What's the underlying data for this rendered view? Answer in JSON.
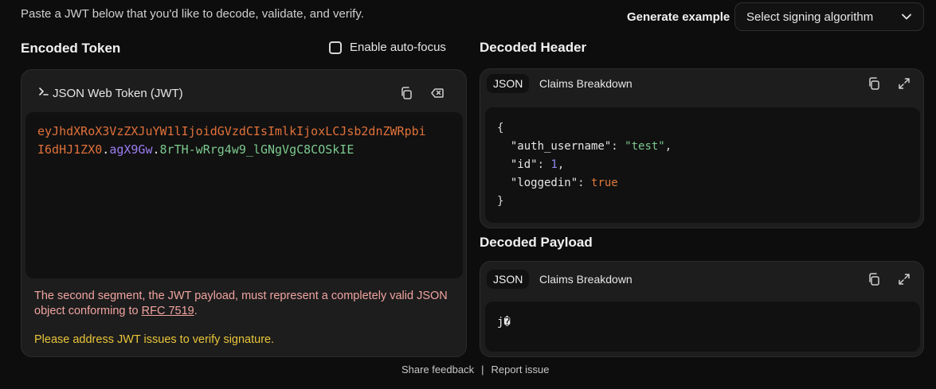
{
  "intro_text": "Paste a JWT below that you'd like to decode, validate, and verify.",
  "generate_example_label": "Generate example",
  "algorithm_select": {
    "value": "Select signing algorithm"
  },
  "encoded": {
    "title": "Encoded Token",
    "autofocus_label": "Enable auto-focus",
    "panel_title": "JSON Web Token (JWT)",
    "token_header_part": "eyJhdXRoX3VzZXJuYW1lIjoidGVzdCIsImlkIjoxLCJsb2dnZWRpbiI6dHJ1ZX0",
    "token_header_line1": "eyJhdXRoX3VzZXJuYW1lIjoidGVzdCIsImlkIjoxLCJsb2dnZWRpbi",
    "token_header_line2": "I6dHJ1ZX0",
    "dot1": ".",
    "token_payload_part": "agX9Gw",
    "dot2": ".",
    "token_signature_part": "8rTH-wRrg4w9_lGNgVgC8COSkIE",
    "error_text": "The second segment, the JWT payload, must represent a completely valid JSON object conforming to ",
    "error_link": "RFC 7519",
    "error_end": ".",
    "warning_text": "Please address JWT issues to verify signature."
  },
  "decoded_header": {
    "title": "Decoded Header",
    "tab_json": "JSON",
    "tab_claims": "Claims Breakdown",
    "open_brace": "{",
    "close_brace": "}",
    "lines": [
      {
        "key": "\"auth_username\"",
        "value": "\"test\""
      },
      {
        "key": "\"id\"",
        "value": "1"
      },
      {
        "key": "\"loggedin\"",
        "value": "true"
      }
    ]
  },
  "decoded_payload": {
    "title": "Decoded Payload",
    "tab_json": "JSON",
    "tab_claims": "Claims Breakdown",
    "content": "j�"
  },
  "footer": {
    "share_feedback": "Share feedback",
    "separator": "|",
    "report_issue": "Report issue"
  },
  "colors": {
    "token_header": "#e0713a",
    "token_payload": "#9a7cf0",
    "token_signature": "#7cc88e",
    "error_text": "#f0a4a0",
    "warning_text": "#e8c53a"
  }
}
